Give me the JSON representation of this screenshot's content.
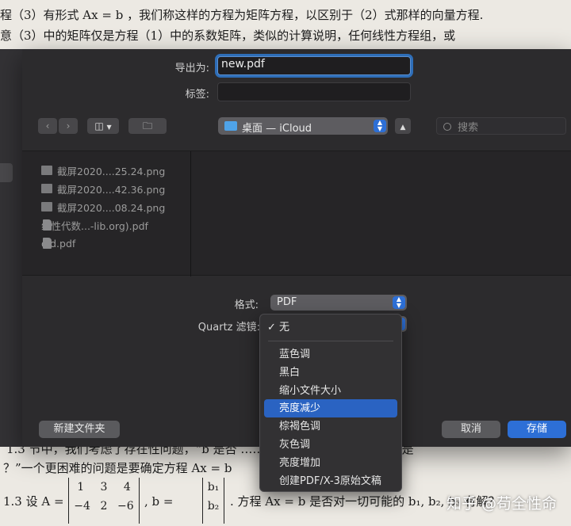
{
  "document": {
    "top_lines": [
      "程（3）有形式 Ax = b ，我们称这样的方程为矩阵方程，以区别于（2）式那样的向量方程.",
      "意（3）中的矩阵仅是方程（1）中的系数矩阵，类似的计算说明，任何线性方程组，或"
    ],
    "bottom_line1": "1.3 节中，我们考虑了存在性问题，“b 是否 ……………… 等价于“Ax = b 是",
    "bottom_line2": "？”一个更困难的问题是要确定方程 Ax = b",
    "bottom_line3_prefix": "1.3  设 A =",
    "bottom_line3_mid": ", b =",
    "bottom_line3_suffix": ". 方程 Ax = b 是否对一切可能的 b₁, b₂, b₃ 有解？",
    "matrix_rows": [
      [
        "1",
        "3",
        "4"
      ],
      [
        "−4",
        "2",
        "−6"
      ]
    ],
    "vector_rows": [
      "b₁",
      "b₂"
    ],
    "watermark": "知乎 @苟全性命"
  },
  "dialog": {
    "export_label": "导出为:",
    "filename": "new.pdf",
    "tags_label": "标签:",
    "tags_value": "",
    "location": "桌面 — iCloud",
    "search_placeholder": "搜索",
    "files": [
      "截屏2020....25.24.png",
      "截屏2020....42.36.png",
      "截屏2020....08.24.png",
      "线性代数...-lib.org).pdf",
      "old.pdf"
    ],
    "format_label": "格式:",
    "format_value": "PDF",
    "quartz_label": "Quartz 滤镜:",
    "new_folder": "新建文件夹",
    "cancel": "取消",
    "save": "存储"
  },
  "quartz_menu": {
    "checked": "无",
    "items": [
      "蓝色调",
      "黑白",
      "缩小文件大小",
      "亮度减少",
      "棕褐色调",
      "灰色调",
      "亮度增加",
      "创建PDF/X-3原始文稿"
    ],
    "highlighted": "亮度减少"
  },
  "colors": {
    "dialog_bg": "#2c2b2d",
    "accent": "#2d6fd6",
    "highlight": "#2a63c2"
  }
}
